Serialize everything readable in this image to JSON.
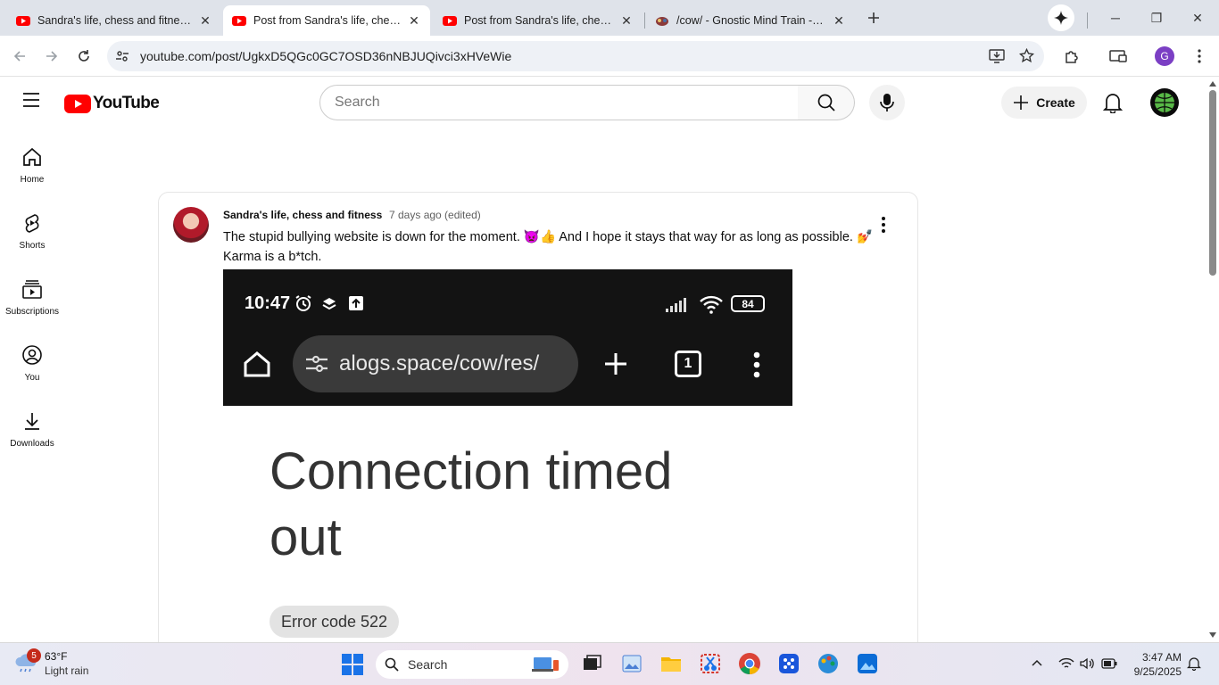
{
  "browser": {
    "tabs": [
      {
        "title": "Sandra's life, chess and fitness -",
        "active": false
      },
      {
        "title": "Post from Sandra's life, chess an",
        "active": true
      },
      {
        "title": "Post from Sandra's life, chess an",
        "active": false
      },
      {
        "title": "/cow/ - Gnostic Mind Train - Jew",
        "active": false
      }
    ],
    "url": "youtube.com/post/UgkxD5QGc0GC7OSD36nNBJUQivci3xHVeWie",
    "profile_initial": "G",
    "accent_color": "#1a73e8"
  },
  "youtube": {
    "logo_text": "YouTube",
    "search_placeholder": "Search",
    "create_label": "Create",
    "sidebar": [
      {
        "label": "Home",
        "icon": "home-icon"
      },
      {
        "label": "Shorts",
        "icon": "shorts-icon"
      },
      {
        "label": "Subscriptions",
        "icon": "subscriptions-icon"
      },
      {
        "label": "You",
        "icon": "you-icon"
      },
      {
        "label": "Downloads",
        "icon": "download-icon"
      }
    ]
  },
  "post": {
    "author": "Sandra's life, chess and fitness",
    "time": "7 days ago (edited)",
    "text_part1": "The stupid bullying website is down for the moment.",
    "emoji1": "👿👍",
    "text_part2": "And I hope it stays that way for as long as possible.",
    "emoji2": "💅",
    "text_part3": "Karma is a b*tch.",
    "screenshot": {
      "time": "10:47",
      "battery": "84",
      "url": "alogs.space/cow/res/",
      "tab_count": "1",
      "heading": "Connection timed out",
      "error": "Error code 522"
    }
  },
  "taskbar": {
    "weather_temp": "63°F",
    "weather_desc": "Light rain",
    "weather_badge": "5",
    "search_label": "Search",
    "time": "3:47 AM",
    "date": "9/25/2025"
  }
}
